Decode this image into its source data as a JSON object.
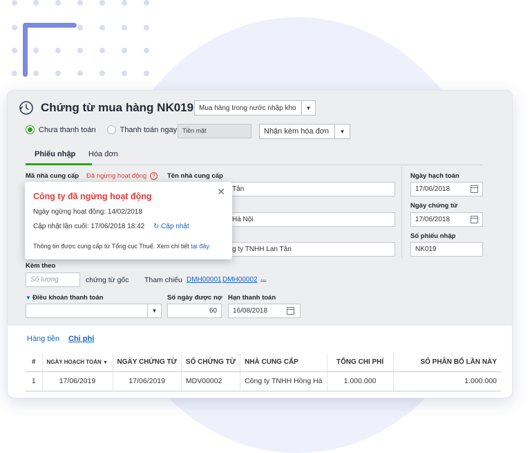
{
  "header": {
    "title": "Chứng từ mua hàng NK019",
    "purchase_type": "Mua hàng trong nước nhập kho"
  },
  "payment": {
    "option_unpaid": "Chưa thanh toán",
    "option_paid": "Thanh toán ngay",
    "method": "Tiền mặt",
    "invoice_option": "Nhận kèm hóa đơn"
  },
  "tabs": [
    "Phiếu nhập",
    "Hóa đơn"
  ],
  "form": {
    "supplier_code_label": "Mã nhà cung cấp",
    "supplier_status": "Đã ngừng hoạt động",
    "supplier_name_label": "Tên nhà cung cấp",
    "supplier_name_value": "Tân",
    "address_value": "Hà Nội",
    "description_value": "g ty TNHH Lan Tân",
    "attached_label": "Kèm theo",
    "quantity_placeholder": "Số lượng",
    "original_docs": "chứng từ gốc",
    "reference_label": "Tham chiếu",
    "ref1": "DMH00001",
    "ref2": "DMH00002",
    "ref_more": "...",
    "payment_terms_label": "Điều khoản thanh toán",
    "credit_days_label": "Số ngày được nợ",
    "credit_days_value": "60",
    "due_date_label": "Hạn thanh toán",
    "due_date_value": "16/08/2018",
    "posting_date_label": "Ngày hạch toán",
    "posting_date_value": "17/06/2018",
    "doc_date_label": "Ngày chứng từ",
    "doc_date_value": "17/06/2018",
    "receipt_no_label": "Số phiếu nhập",
    "receipt_no_value": "NK019"
  },
  "popover": {
    "title": "Công ty đã ngừng hoạt động",
    "stop_date": "Ngày ngừng hoạt động: 14/02/2018",
    "last_update": "Cập nhật lần cuối: 17/06/2018 18:42",
    "refresh_label": "Cập nhật",
    "source_text": "Thông tin được cung cấp từ Tổng cục Thuế. Xem chi tiết",
    "source_link": "tại đây",
    "source_end": "."
  },
  "detail_tabs": [
    "Hàng tiền",
    "Chi phí"
  ],
  "table": {
    "headers": [
      "#",
      "NGÀY HOẠCH TOÁN",
      "NGÀY CHỨNG TỪ",
      "SỐ CHỨNG TỪ",
      "NHÀ CUNG CẤP",
      "TỔNG CHI PHÍ",
      "SỐ PHÂN BỔ LẦN NÀY"
    ],
    "rows": [
      [
        "1",
        "17/06/2019",
        "17/06/2019",
        "MDV00002",
        "Công ty TNHH Hồng Hà",
        "1.000.000",
        "1.000.000"
      ]
    ]
  },
  "colors": {
    "accent_green": "#2ca01c",
    "error_red": "#e53935",
    "link_blue": "#1565c0"
  }
}
